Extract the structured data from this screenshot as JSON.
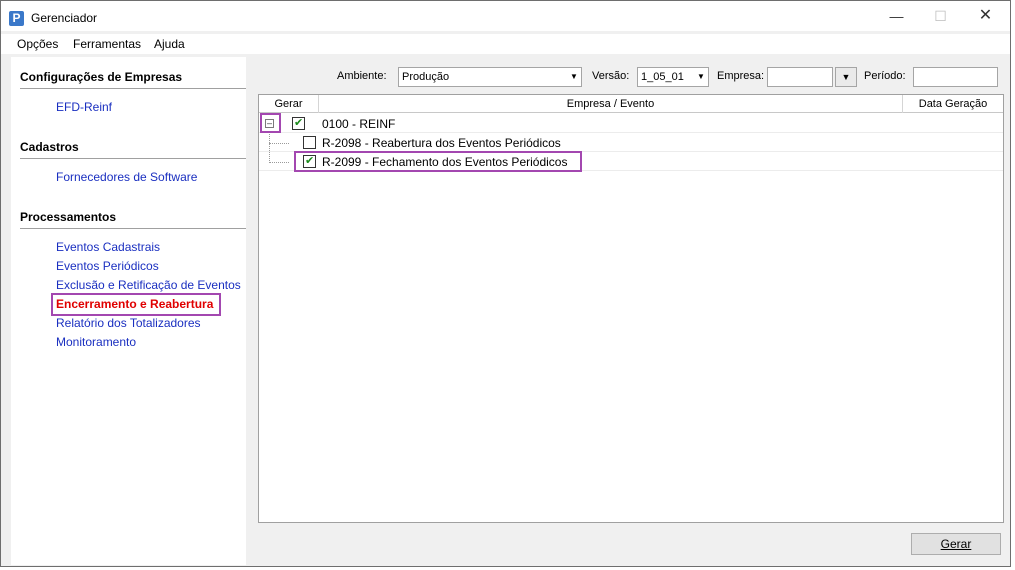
{
  "window": {
    "title": "Gerenciador",
    "icon_letter": "P"
  },
  "menu": {
    "items": [
      "Opções",
      "Ferramentas",
      "Ajuda"
    ]
  },
  "sidebar": {
    "sections": [
      {
        "title": "Configurações de Empresas",
        "links": [
          "EFD-Reinf"
        ]
      },
      {
        "title": "Cadastros",
        "links": [
          "Fornecedores de Software"
        ]
      },
      {
        "title": "Processamentos",
        "links": [
          "Eventos Cadastrais",
          "Eventos Periódicos",
          "Exclusão e Retificação de Eventos",
          "Encerramento e Reabertura",
          "Relatório dos Totalizadores",
          "Monitoramento"
        ]
      }
    ],
    "active_link": "Encerramento e Reabertura"
  },
  "filters": {
    "ambiente_label": "Ambiente:",
    "ambiente_value": "Produção",
    "versao_label": "Versão:",
    "versao_value": "1_05_01",
    "empresa_label": "Empresa:",
    "empresa_value": "",
    "periodo_label": "Período:",
    "periodo_value": ""
  },
  "grid": {
    "columns": [
      "Gerar",
      "Empresa / Evento",
      "Data Geração"
    ],
    "rows": [
      {
        "text": "0100 - REINF",
        "checked": true,
        "level": 0,
        "expanded": true
      },
      {
        "text": "R-2098 - Reabertura dos Eventos Periódicos",
        "checked": false,
        "level": 1
      },
      {
        "text": "R-2099 - Fechamento dos Eventos Periódicos",
        "checked": true,
        "level": 1
      }
    ]
  },
  "actions": {
    "gerar_label": "Gerar"
  },
  "colors": {
    "link": "#1a2fc0",
    "active_link": "#e00000",
    "highlight": "#a347b0",
    "check": "#1b8a1b"
  },
  "icons": {
    "app": "app-logo-icon",
    "minimize": "minimize-icon",
    "maximize": "maximize-icon",
    "close": "close-icon",
    "dropdown": "chevron-down-icon",
    "collapse": "collapse-tree-icon",
    "checkbox": "checkbox-icon"
  }
}
